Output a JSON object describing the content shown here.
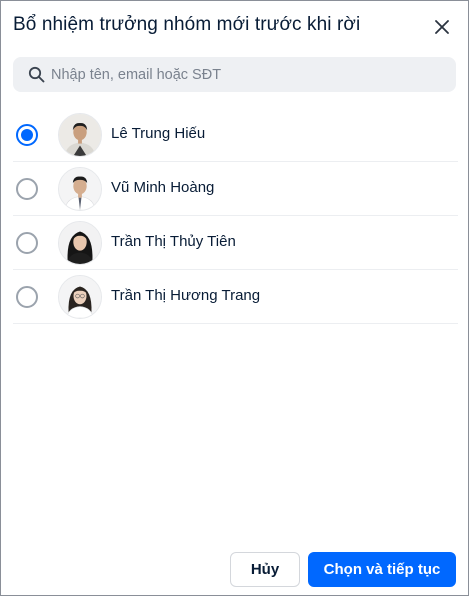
{
  "dialog": {
    "title": "Bổ nhiệm trưởng nhóm mới trước khi rời",
    "close_icon": "close-icon"
  },
  "search": {
    "placeholder": "Nhập tên, email hoặc SĐT",
    "value": "",
    "icon": "search-icon"
  },
  "members": [
    {
      "name": "Lê Trung Hiếu",
      "selected": true
    },
    {
      "name": "Vũ Minh Hoàng",
      "selected": false
    },
    {
      "name": "Trần Thị Thủy Tiên",
      "selected": false
    },
    {
      "name": "Trần Thị Hương Trang",
      "selected": false
    }
  ],
  "footer": {
    "cancel_label": "Hủy",
    "confirm_label": "Chọn và tiếp tục"
  },
  "colors": {
    "accent": "#0068ff",
    "text": "#081c36",
    "search_bg": "#eef0f3"
  }
}
